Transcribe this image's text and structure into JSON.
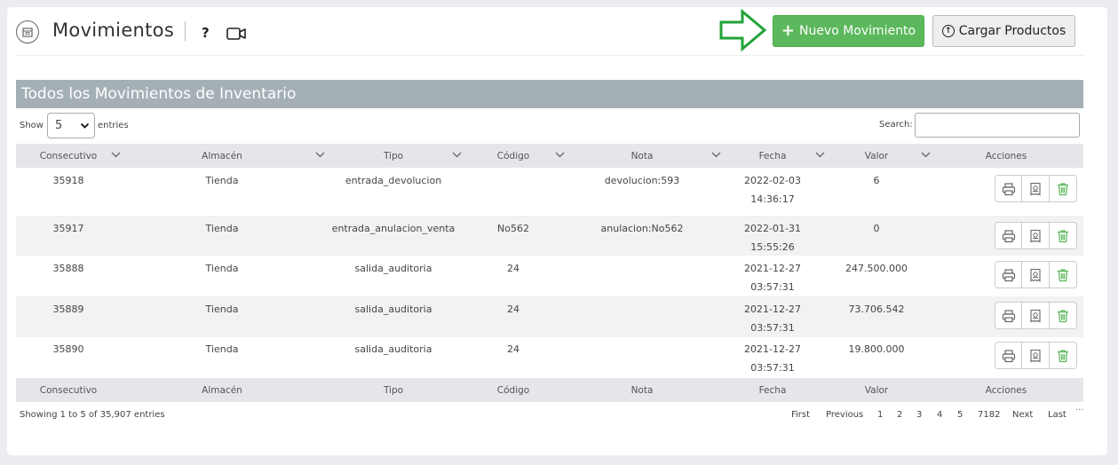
{
  "header": {
    "title": "Movimientos",
    "help": "?",
    "new_button": "Nuevo Movimiento",
    "load_button": "Cargar Productos"
  },
  "section": {
    "title": "Todos los Movimientos de Inventario",
    "show_label": "Show",
    "show_value": "5",
    "entries_label": "entries",
    "search_label": "Search:",
    "search_value": ""
  },
  "table": {
    "columns": [
      "Consecutivo",
      "Almacén",
      "Tipo",
      "Código",
      "Nota",
      "Fecha",
      "Valor",
      "Acciones"
    ],
    "rows": [
      {
        "consecutivo": "35918",
        "almacen": "Tienda",
        "tipo": "entrada_devolucion",
        "codigo": "",
        "nota": "devolucion:593",
        "fecha": "2022-02-03",
        "fecha2": "14:36:17",
        "valor": "6"
      },
      {
        "consecutivo": "35917",
        "almacen": "Tienda",
        "tipo": "entrada_anulacion_venta",
        "codigo": "No562",
        "nota": "anulacion:No562",
        "fecha": "2022-01-31 15:55:26",
        "fecha2": "",
        "valor": "0"
      },
      {
        "consecutivo": "35888",
        "almacen": "Tienda",
        "tipo": "salida_auditoria",
        "codigo": "24",
        "nota": "",
        "fecha": "2021-12-27 03:57:31",
        "fecha2": "",
        "valor": "247.500.000"
      },
      {
        "consecutivo": "35889",
        "almacen": "Tienda",
        "tipo": "salida_auditoria",
        "codigo": "24",
        "nota": "",
        "fecha": "2021-12-27 03:57:31",
        "fecha2": "",
        "valor": "73.706.542"
      },
      {
        "consecutivo": "35890",
        "almacen": "Tienda",
        "tipo": "salida_auditoria",
        "codigo": "24",
        "nota": "",
        "fecha": "2021-12-27 03:57:31",
        "fecha2": "",
        "valor": "19.800.000"
      }
    ]
  },
  "footer": {
    "info": "Showing 1 to 5 of 35,907 entries",
    "pagination": [
      "First",
      "Previous",
      "1",
      "2",
      "3",
      "4",
      "5",
      "7182",
      "Next",
      "Last"
    ],
    "more": "···"
  },
  "colors": {
    "accent_green": "#5cb85c",
    "arrow_green": "#22a33a",
    "section_bar": "#a5b0b6",
    "trash_green": "#5cb85c"
  },
  "icons": [
    "box-icon",
    "video-icon",
    "plus-icon",
    "upload-icon",
    "chevron-down-icon",
    "print-icon",
    "receipt-icon",
    "trash-icon",
    "arrow-right-icon"
  ]
}
